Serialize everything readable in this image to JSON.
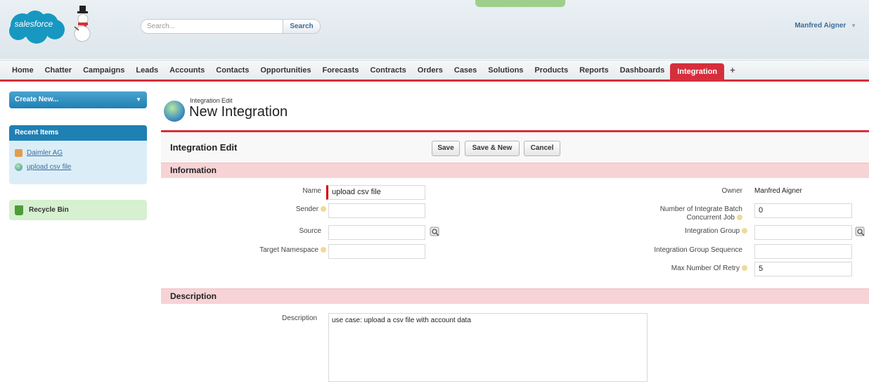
{
  "header": {
    "logo_text": "salesforce",
    "search_placeholder": "Search...",
    "search_button": "Search",
    "user_name": "Manfred Aigner",
    "user_menu_arrow": "▼"
  },
  "tabs": [
    "Home",
    "Chatter",
    "Campaigns",
    "Leads",
    "Accounts",
    "Contacts",
    "Opportunities",
    "Forecasts",
    "Contracts",
    "Orders",
    "Cases",
    "Solutions",
    "Products",
    "Reports",
    "Dashboards",
    "Integration"
  ],
  "active_tab": "Integration",
  "tab_plus": "+",
  "sidebar": {
    "create_new": "Create New...",
    "create_new_arrow": "▼",
    "recent_items_title": "Recent Items",
    "recent_items": [
      "Daimler AG",
      "upload csv file"
    ],
    "recycle_bin": "Recycle Bin"
  },
  "page": {
    "type_label": "Integration Edit",
    "title": "New Integration",
    "block_title": "Integration Edit",
    "buttons": {
      "save": "Save",
      "save_new": "Save & New",
      "cancel": "Cancel"
    }
  },
  "sections": {
    "information": "Information",
    "description": "Description"
  },
  "fields": {
    "name_label": "Name",
    "name_value": "upload csv file",
    "sender_label": "Sender",
    "source_label": "Source",
    "target_namespace_label": "Target Namespace",
    "owner_label": "Owner",
    "owner_value": "Manfred Aigner",
    "batch_label_1": "Number of Integrate Batch",
    "batch_label_2": "Concurrent Job",
    "batch_value": "0",
    "group_label": "Integration Group",
    "group_seq_label": "Integration Group Sequence",
    "retry_label": "Max Number Of Retry",
    "retry_value": "5",
    "description_label": "Description",
    "description_value": "use case: upload a csv file with account data"
  },
  "colors": {
    "brand_red": "#d62f3c",
    "brand_blue": "#1f80b4",
    "section_pink": "#f7d3d6",
    "sidebar_blue": "#dbeef8",
    "recycle_green": "#d6f0d0"
  }
}
